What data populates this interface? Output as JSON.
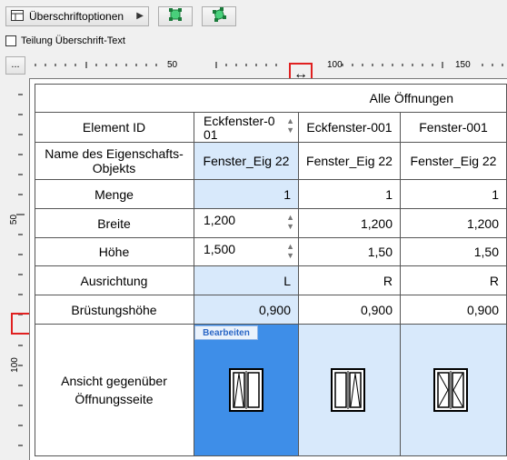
{
  "toolbar": {
    "options_label": "Überschriftoptionen",
    "options_icon": "table-header-icon",
    "dropdown_icon": "triangle-right-icon",
    "button1_icon": "select-frame-icon",
    "button2_icon": "transform-frame-icon"
  },
  "split_checkbox": {
    "label": "Teilung Überschrift-Text",
    "checked": false
  },
  "dots_button": "...",
  "ruler_h": {
    "labels": [
      "50",
      "100",
      "150"
    ]
  },
  "ruler_v": {
    "labels": [
      "50",
      "100"
    ]
  },
  "table": {
    "group_header": "Alle Öffnungen",
    "rows": {
      "element_id": {
        "label": "Element ID",
        "values": [
          "Eckfenster-001",
          "Eckfenster-001",
          "Fenster-001"
        ]
      },
      "property_object": {
        "label": "Name des Eigenschafts-Objekts",
        "values": [
          "Fenster_Eig 22",
          "Fenster_Eig 22",
          "Fenster_Eig 22"
        ]
      },
      "quantity": {
        "label": "Menge",
        "values": [
          "1",
          "1",
          "1"
        ]
      },
      "width": {
        "label": "Breite",
        "values": [
          "1,200",
          "1,200",
          "1,200"
        ]
      },
      "height": {
        "label": "Höhe",
        "values": [
          "1,500",
          "1,50",
          "1,50"
        ]
      },
      "orientation": {
        "label": "Ausrichtung",
        "values": [
          "L",
          "R",
          "R"
        ]
      },
      "sill_height": {
        "label": "Brüstungshöhe",
        "values": [
          "0,900",
          "0,900",
          "0,900"
        ]
      },
      "view": {
        "label": "Ansicht gegenüber Öffnungsseite",
        "edit_badge": "Bearbeiten"
      }
    }
  },
  "colors": {
    "selected": "#3e8ee8",
    "editable": "#d8e9fb",
    "highlight": "#e02020"
  }
}
